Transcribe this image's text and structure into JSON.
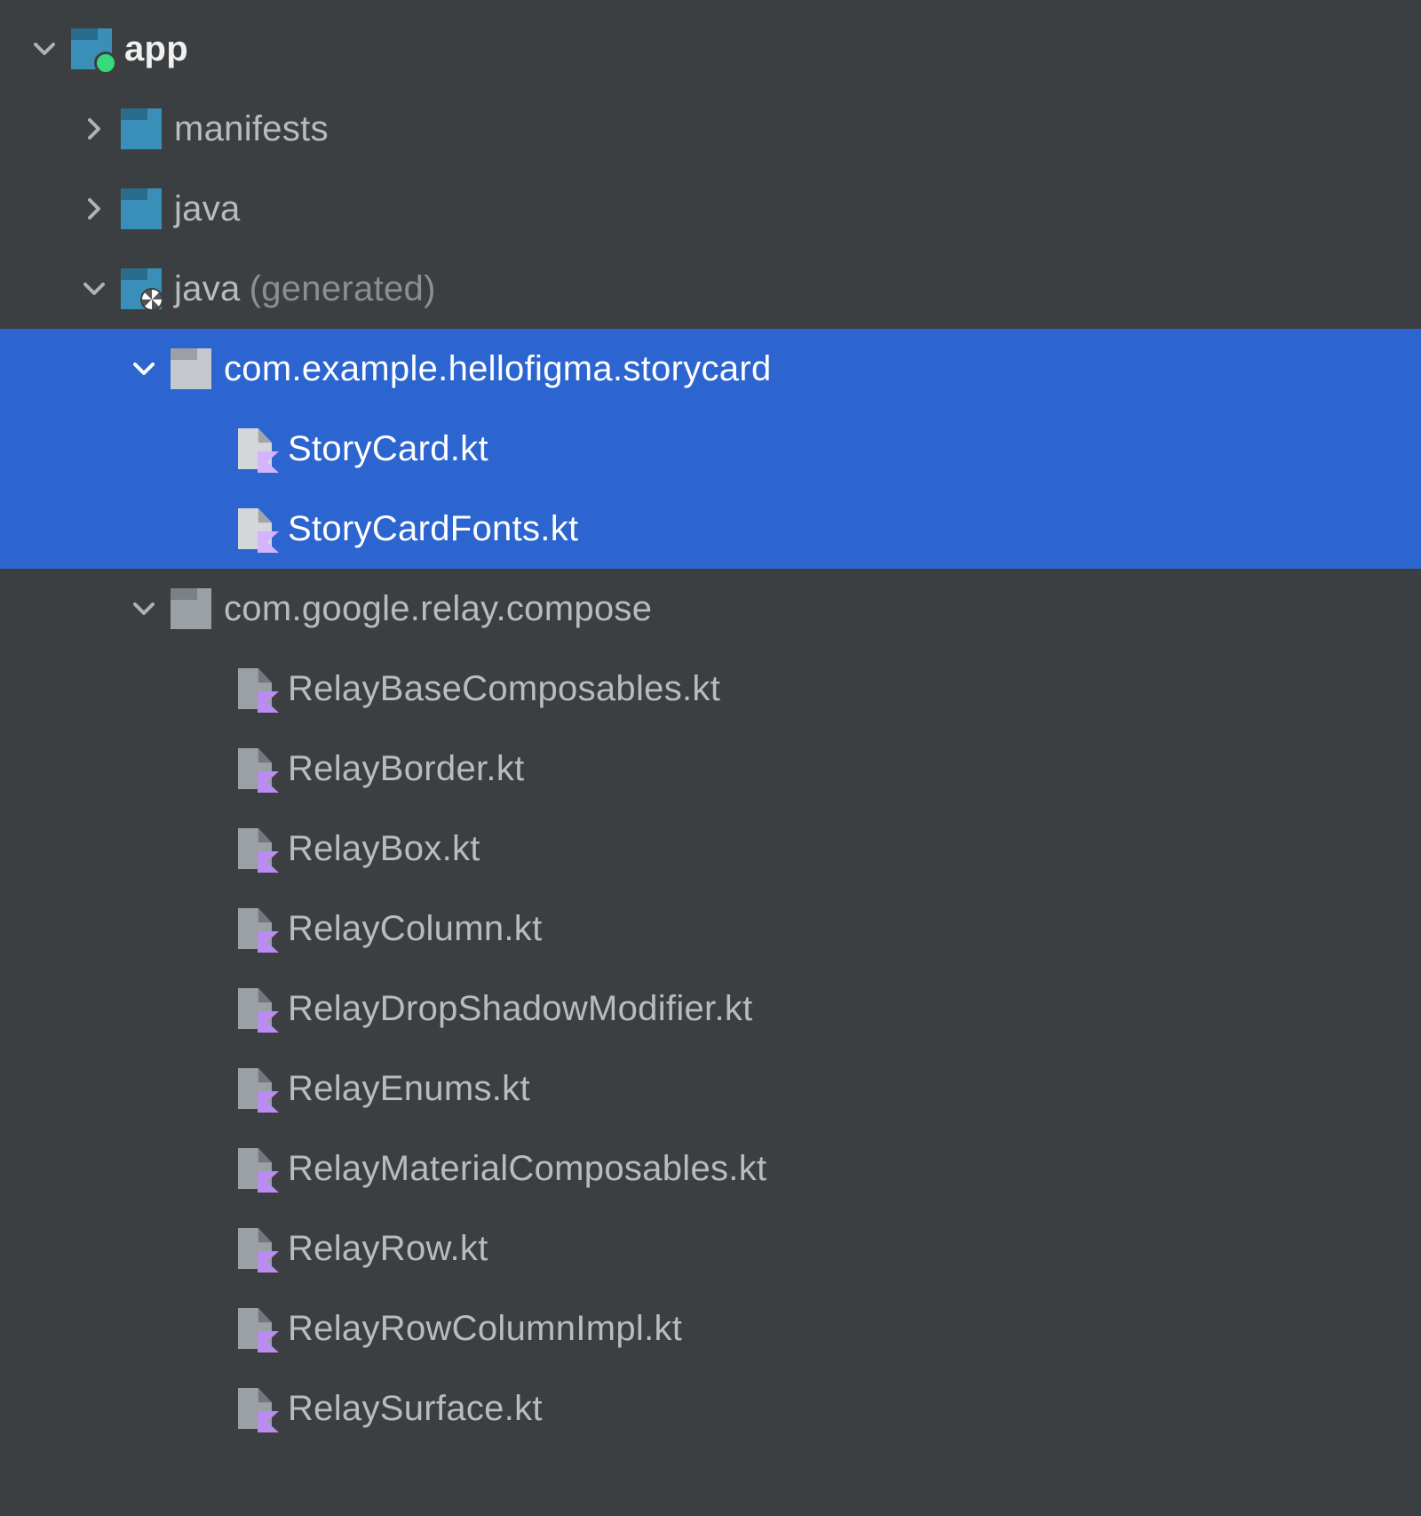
{
  "colors": {
    "background": "#3c3f41",
    "selection": "#2c65cf",
    "text": "#bbbbbb",
    "textBold": "#f0f0f0",
    "textFaded": "#8a8f93",
    "folderTeal": "#3a8fb9",
    "folderGrey": "#9aa0a6",
    "kotlinPurple": "#b98cf0",
    "moduleDot": "#37d97a"
  },
  "root": {
    "label": "app",
    "expanded": true,
    "selected": false,
    "children": [
      {
        "label": "manifests",
        "expanded": false,
        "icon": "folder",
        "selected": false
      },
      {
        "label": "java",
        "expanded": false,
        "icon": "folder",
        "selected": false
      },
      {
        "label": "java",
        "suffix": "(generated)",
        "expanded": true,
        "icon": "folder-generated",
        "selected": false,
        "children": [
          {
            "label": "com.example.hellofigma.storycard",
            "expanded": true,
            "icon": "package",
            "selected": true,
            "files": [
              {
                "label": "StoryCard.kt",
                "selected": true
              },
              {
                "label": "StoryCardFonts.kt",
                "selected": true
              }
            ]
          },
          {
            "label": "com.google.relay.compose",
            "expanded": true,
            "icon": "package",
            "selected": false,
            "files": [
              {
                "label": "RelayBaseComposables.kt",
                "selected": false
              },
              {
                "label": "RelayBorder.kt",
                "selected": false
              },
              {
                "label": "RelayBox.kt",
                "selected": false
              },
              {
                "label": "RelayColumn.kt",
                "selected": false
              },
              {
                "label": "RelayDropShadowModifier.kt",
                "selected": false
              },
              {
                "label": "RelayEnums.kt",
                "selected": false
              },
              {
                "label": "RelayMaterialComposables.kt",
                "selected": false
              },
              {
                "label": "RelayRow.kt",
                "selected": false
              },
              {
                "label": "RelayRowColumnImpl.kt",
                "selected": false
              },
              {
                "label": "RelaySurface.kt",
                "selected": false
              }
            ]
          }
        ]
      }
    ]
  }
}
